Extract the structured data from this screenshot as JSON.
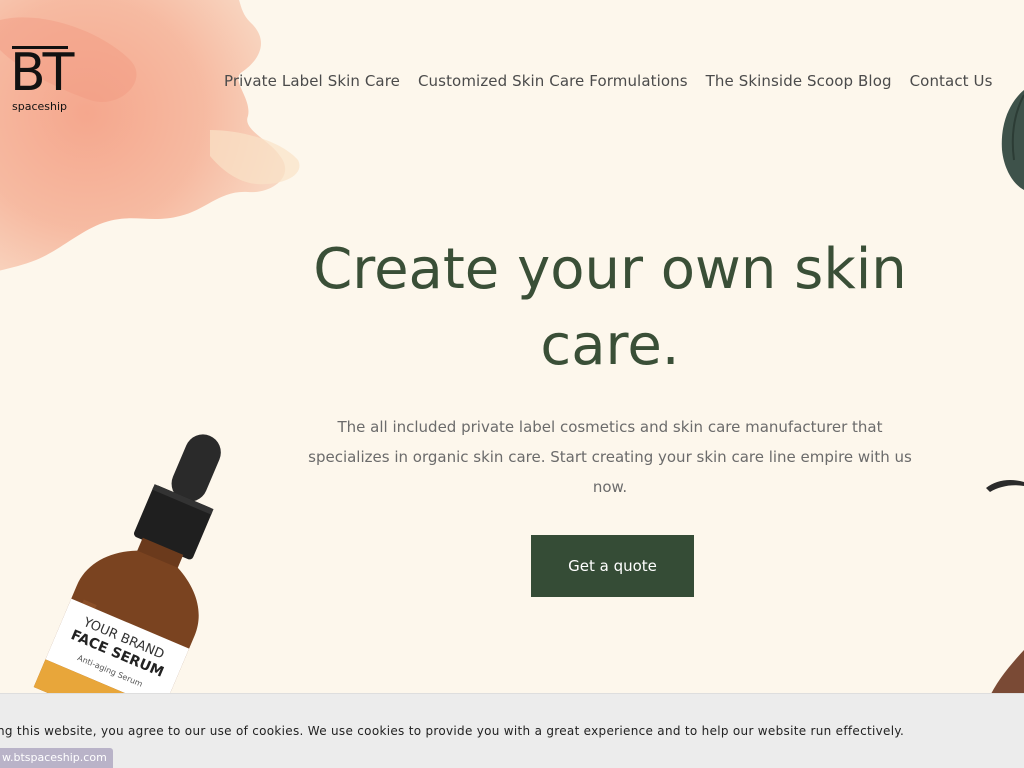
{
  "logo": {
    "mark": "BT",
    "sub": "spaceship"
  },
  "nav": {
    "items": [
      {
        "label": "Private Label Skin Care"
      },
      {
        "label": "Customized Skin Care Formulations"
      },
      {
        "label": "The Skinside Scoop Blog"
      },
      {
        "label": "Contact Us"
      }
    ]
  },
  "hero": {
    "title": "Create your own skin care.",
    "subtitle": "The all included private label cosmetics and skin care manufacturer that specializes in organic skin care. Start creating your skin care line empire with us now.",
    "cta_label": "Get a quote"
  },
  "product": {
    "label_line1": "YOUR BRAND",
    "label_line2": "FACE SERUM",
    "label_line3": "Anti-aging Serum"
  },
  "cookie": {
    "text": "ng this website, you agree to our use of cookies. We use cookies to provide you with a great experience and to help our website run effectively."
  },
  "status": {
    "url": "w.btspaceship.com"
  },
  "colors": {
    "background": "#fdf7ec",
    "accent": "#354c36",
    "heading": "#3a4f37",
    "splash": "#f4a98f"
  }
}
